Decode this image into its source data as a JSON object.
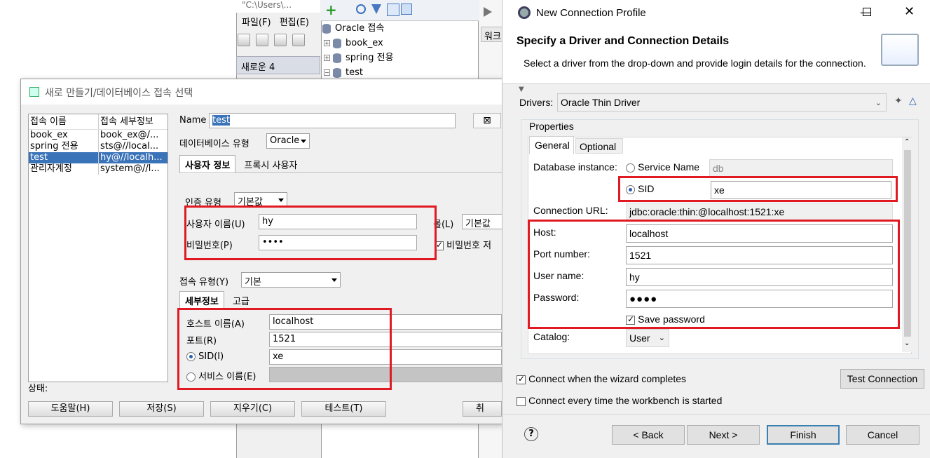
{
  "background_app": {
    "window_path": "\"C:\\Users\\...",
    "menu": [
      "파일(F)",
      "편집(E)"
    ],
    "tab_label": "새로운 4",
    "tree": {
      "root": "Oracle 접속",
      "children": [
        "book_ex",
        "spring 전용",
        "test"
      ]
    },
    "worksheet_tab": "워크"
  },
  "kr_dialog": {
    "title": "새로 만들기/데이터베이스 접속 선택",
    "table": {
      "headers": [
        "접속 이름",
        "접속 세부정보"
      ],
      "rows": [
        {
          "name": "book_ex",
          "detail": "book_ex@/..."
        },
        {
          "name": "spring 전용",
          "detail": "sts@//local..."
        },
        {
          "name": "test",
          "detail": "hy@//localh..."
        },
        {
          "name": "관리자계정",
          "detail": "system@//l..."
        }
      ],
      "selected_index": 2
    },
    "name_label": "Name",
    "name_value": "test",
    "db_type_label": "데이터베이스 유형",
    "db_type_value": "Oracle",
    "tabs": [
      "사용자 정보",
      "프록시 사용자"
    ],
    "auth_type_label": "인증 유형",
    "auth_type_value": "기본값",
    "username_label": "사용자 이름(U)",
    "username_value": "hy",
    "password_label": "비밀번호(P)",
    "password_value": "••••",
    "role_label": "롤(L)",
    "role_value": "기본값",
    "save_password_label": "비밀번호 저",
    "conn_type_label": "접속 유형(Y)",
    "conn_type_value": "기본",
    "detail_tabs": [
      "세부정보",
      "고급"
    ],
    "host_label": "호스트 이름(A)",
    "host_value": "localhost",
    "port_label": "포트(R)",
    "port_value": "1521",
    "sid_label": "SID(I)",
    "sid_value": "xe",
    "service_label": "서비스 이름(E)",
    "status_label": "상태:",
    "buttons": [
      "도움말(H)",
      "저장(S)",
      "지우기(C)",
      "테스트(T)",
      "취"
    ]
  },
  "eclipse": {
    "title": "New Connection Profile",
    "header_title": "Specify a Driver and Connection Details",
    "header_desc": "Select a driver from the drop-down and provide login details for the connection.",
    "drivers_label": "Drivers:",
    "driver_value": "Oracle Thin Driver",
    "properties_label": "Properties",
    "tabs": [
      "General",
      "Optional"
    ],
    "db_instance_label": "Database instance:",
    "service_name_label": "Service Name",
    "service_name_value": "db",
    "sid_label": "SID",
    "sid_value": "xe",
    "conn_url_label": "Connection URL:",
    "conn_url_value": "jdbc:oracle:thin:@localhost:1521:xe",
    "host_label": "Host:",
    "host_value": "localhost",
    "port_label": "Port number:",
    "port_value": "1521",
    "user_label": "User name:",
    "user_value": "hy",
    "password_label": "Password:",
    "password_value": "●●●●",
    "save_password_label": "Save password",
    "catalog_label": "Catalog:",
    "catalog_value": "User",
    "connect_wizard_label": "Connect when the wizard completes",
    "connect_every_label": "Connect every time the workbench is started",
    "test_connection": "Test Connection",
    "back": "< Back",
    "next": "Next >",
    "finish": "Finish",
    "cancel": "Cancel"
  },
  "colors": {
    "highlight_red": "#e01a22",
    "selection_blue": "#3b73b9",
    "dialog_bg": "#f0f0f0"
  }
}
